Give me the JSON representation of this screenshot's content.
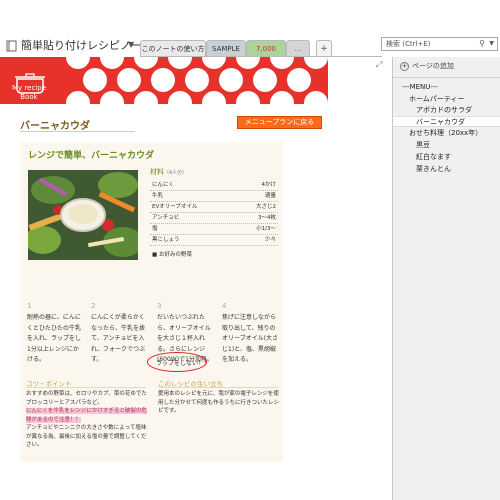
{
  "notebook": {
    "title": "簡単貼り付けレシピノート",
    "tabs": [
      {
        "label": "このノートの使い方"
      },
      {
        "label": "SAMPLE"
      },
      {
        "label": "7,000"
      },
      {
        "label": "…"
      },
      {
        "label": "+"
      }
    ]
  },
  "search": {
    "placeholder": "検索 (Ctrl+E)"
  },
  "sidebar": {
    "add_page_label": "ページの追加",
    "pages": [
      {
        "label": "---MENU---"
      },
      {
        "label": "ホームパーティー"
      },
      {
        "label": "アボカドのサラダ"
      },
      {
        "label": "バーニャカウダ"
      },
      {
        "label": "おせち料理（20xx年）"
      },
      {
        "label": "黒豆"
      },
      {
        "label": "紅白なます"
      },
      {
        "label": "栗きんとん"
      }
    ]
  },
  "banner": {
    "book_label_line1": "My recipe",
    "book_label_line2": "Book"
  },
  "recipe": {
    "title": "バーニャカウダ",
    "menu_plan_button": "メニュープランに戻る",
    "card_title": "レンジで簡単、バーニャカウダ",
    "ingredients_title": "材料",
    "servings": "（4人分）",
    "ingredients": [
      {
        "name": "にんにく",
        "qty": "4かけ"
      },
      {
        "name": "牛乳",
        "qty": "適量"
      },
      {
        "name": "EVオリーブオイル",
        "qty": "大さじ2"
      },
      {
        "name": "アンチョビ",
        "qty": "3〜4枚"
      },
      {
        "name": "塩",
        "qty": "小1/3〜"
      },
      {
        "name": "黒こしょう",
        "qty": "少々"
      }
    ],
    "optional": "■ お好みの野菜",
    "steps": [
      {
        "num": "1",
        "text": "耐熱の器に、にんにくとひたひたの牛乳を入れ、ラップをし1分以上レンジにかける。"
      },
      {
        "num": "2",
        "text": "にんにくが柔らかくなったら、牛乳を捨て、アンチョビを入れ、フォークでつぶす。"
      },
      {
        "num": "3",
        "text": "だいたいつぶれたら、オリーブオイルを大さじ１杯入れる。さらにレンジ(600W)で1分加熱。"
      },
      {
        "num": "4",
        "text": "焦げに注意しながら取り出して、残りのオリーブオイル(大さじ1)と、塩、黒胡椒を加える。"
      }
    ],
    "wrap_note": "ラップをしない！！",
    "point_head": "コツ・ポイント",
    "point_text_1": "おすすめの野菜は、セロリやカブ、菜の花ゆでたブロッコリーとアスパラなど。",
    "point_text_hl": "にんにくを牛乳をレンジにかけすぎると破裂の危険があるので注意！！",
    "point_text_2": "アンチョビやニンニクの大きさや数によって塩味が異なる為、最後に加える塩の量で調整してください。",
    "pot_head": "このレシピの生い立ち",
    "pot_text": "愛用本のレシピを元に、我が家の電子レンジを使用した分かせて何度も作るうちに行きついたレシピです。"
  },
  "colors": {
    "banner_red": "#e6322a",
    "button_orange": "#ff6a1a",
    "title_brown": "#7a5a1e",
    "card_title_green": "#6b8e23"
  }
}
